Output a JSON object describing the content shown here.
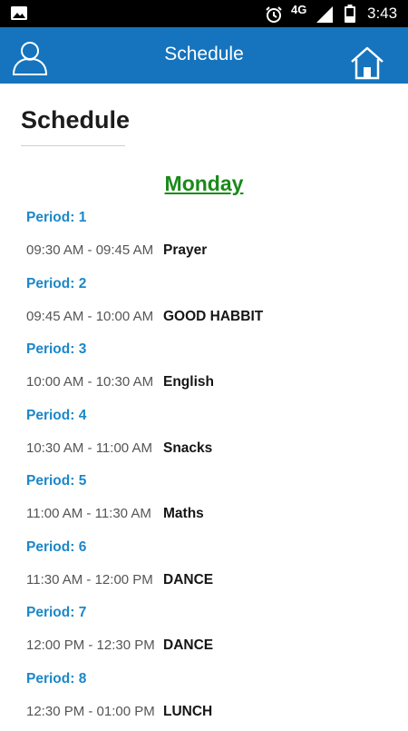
{
  "status_bar": {
    "network": "4G",
    "time": "3:43"
  },
  "app_bar": {
    "title": "Schedule"
  },
  "page": {
    "title": "Schedule",
    "day": "Monday"
  },
  "schedule": [
    {
      "period": "Period: 1",
      "time": "09:30 AM - 09:45 AM",
      "subject": "Prayer"
    },
    {
      "period": "Period: 2",
      "time": "09:45 AM - 10:00 AM",
      "subject": "GOOD HABBIT"
    },
    {
      "period": "Period: 3",
      "time": "10:00 AM - 10:30 AM",
      "subject": "English"
    },
    {
      "period": "Period: 4",
      "time": "10:30 AM - 11:00 AM",
      "subject": "Snacks"
    },
    {
      "period": "Period: 5",
      "time": "11:00 AM - 11:30 AM",
      "subject": "Maths"
    },
    {
      "period": "Period: 6",
      "time": "11:30 AM - 12:00 PM",
      "subject": "DANCE"
    },
    {
      "period": "Period: 7",
      "time": "12:00 PM - 12:30 PM",
      "subject": "DANCE"
    },
    {
      "period": "Period: 8",
      "time": "12:30 PM - 01:00 PM",
      "subject": "LUNCH"
    }
  ],
  "colors": {
    "app_bar": "#1574bd",
    "period_label": "#1b87c9",
    "day_heading": "#1a8a1a"
  },
  "icons": {
    "user": "user-icon",
    "home": "home-icon"
  }
}
